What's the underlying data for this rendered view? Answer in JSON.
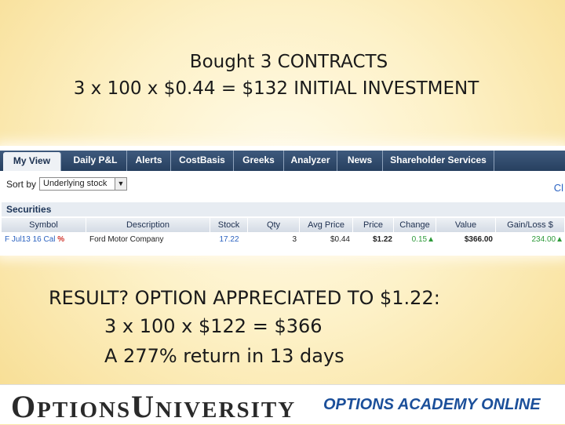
{
  "headline": {
    "line1": "Bought 3 CONTRACTS",
    "line2": "3 x 100 x $0.44 = $132 INITIAL INVESTMENT"
  },
  "tabs": [
    {
      "label": "My View",
      "active": true
    },
    {
      "label": "Daily P&L",
      "active": false
    },
    {
      "label": "Alerts",
      "active": false
    },
    {
      "label": "CostBasis",
      "active": false
    },
    {
      "label": "Greeks",
      "active": false
    },
    {
      "label": "Analyzer",
      "active": false
    },
    {
      "label": "News",
      "active": false
    },
    {
      "label": "Shareholder Services",
      "active": false
    }
  ],
  "sort": {
    "label": "Sort by",
    "value": "Underlying stock"
  },
  "clip_text": "Cl",
  "section_title": "Securities",
  "columns": [
    "Symbol",
    "Description",
    "Stock",
    "Qty",
    "Avg Price",
    "Price",
    "Change",
    "Value",
    "Gain/Loss $"
  ],
  "row": {
    "symbol": "F Jul13 16 Cal",
    "symbol_flag": "%",
    "description": "Ford Motor Company",
    "stock": "17.22",
    "qty": "3",
    "avg_price": "$0.44",
    "price": "$1.22",
    "change": "0.15",
    "value": "$366.00",
    "gain_loss": "234.00"
  },
  "result": {
    "line1": "RESULT?  OPTION APPRECIATED TO $1.22:",
    "line2": "3 x 100 x $122 = $366",
    "line3": "A 277% return in 13 days"
  },
  "footer": {
    "logo_word1_first": "O",
    "logo_word1_rest": "PTIONS",
    "logo_word2_first": "U",
    "logo_word2_rest": "NIVERSITY",
    "tagline": "OPTIONS ACADEMY ONLINE"
  },
  "colors": {
    "tab_bar": "#27405f",
    "link_blue": "#2b62c0",
    "up_green": "#2e9a3a",
    "flag_red": "#d0342c",
    "academy_blue": "#1b4f9a"
  }
}
